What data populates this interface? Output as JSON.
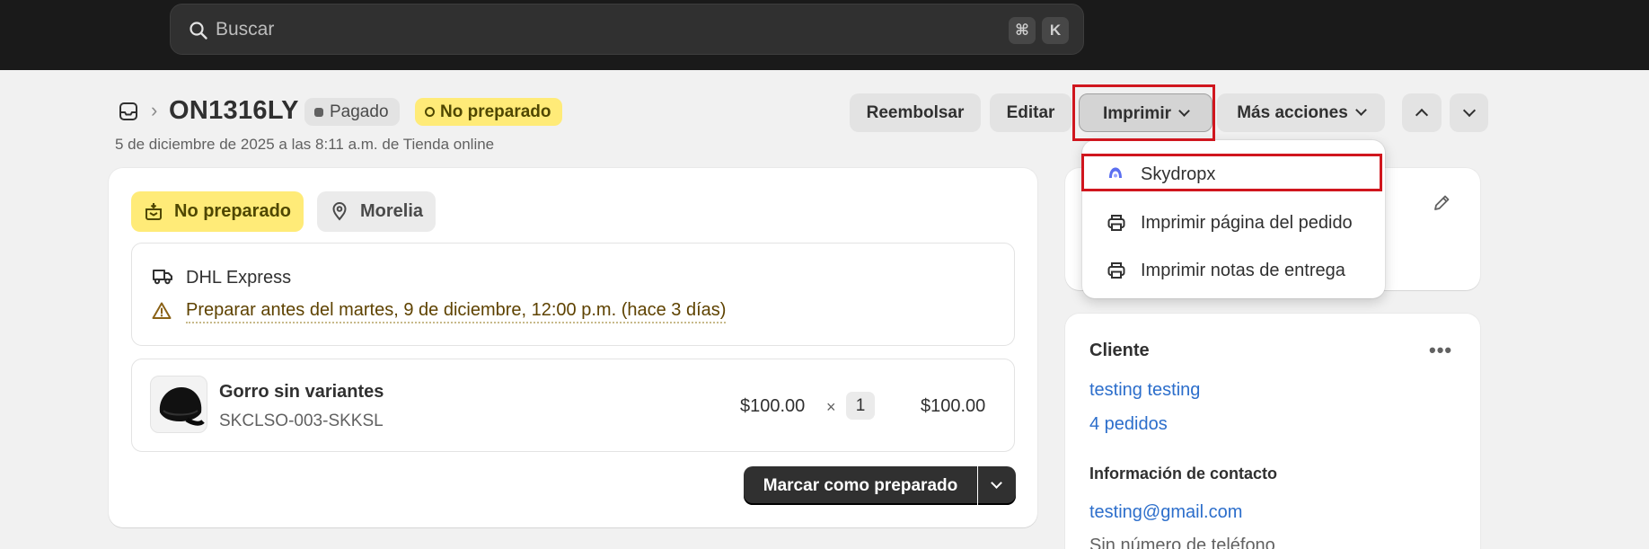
{
  "search": {
    "placeholder": "Buscar",
    "shortcut_cmd": "⌘",
    "shortcut_key": "K"
  },
  "header": {
    "order_number": "ON1316LY",
    "payment_badge": "Pagado",
    "fulfillment_badge": "No preparado",
    "date_line": "5 de diciembre de 2025 a las 8:11 a.m. de Tienda online",
    "actions": {
      "refund": "Reembolsar",
      "edit": "Editar",
      "print": "Imprimir",
      "more": "Más acciones"
    }
  },
  "print_menu": {
    "items": [
      {
        "label": "Skydropx",
        "icon": "skydropx-icon"
      },
      {
        "label": "Imprimir página del pedido",
        "icon": "printer-icon"
      },
      {
        "label": "Imprimir notas de entrega",
        "icon": "printer-icon"
      }
    ]
  },
  "fulfillment_card": {
    "status_tag": "No preparado",
    "location_tag": "Morelia",
    "carrier": "DHL Express",
    "deadline": "Preparar antes del martes, 9 de diciembre, 12:00 p.m. (hace 3 días)",
    "item": {
      "name": "Gorro sin variantes",
      "sku": "SKCLSO-003-SKKSL",
      "price": "$100.00",
      "times": "×",
      "quantity": "1",
      "total": "$100.00"
    },
    "primary_button": "Marcar como preparado"
  },
  "customer_card": {
    "title": "Cliente",
    "name": "testing testing",
    "orders": "4 pedidos",
    "contact_title": "Información de contacto",
    "email": "testing@gmail.com",
    "phone": "Sin número de teléfono"
  },
  "colors": {
    "topbar": "#1a1a1a",
    "warning_badge": "#ffeb78",
    "link": "#2c6ecb",
    "primary_button": "#303030",
    "highlight": "#d0161e"
  }
}
